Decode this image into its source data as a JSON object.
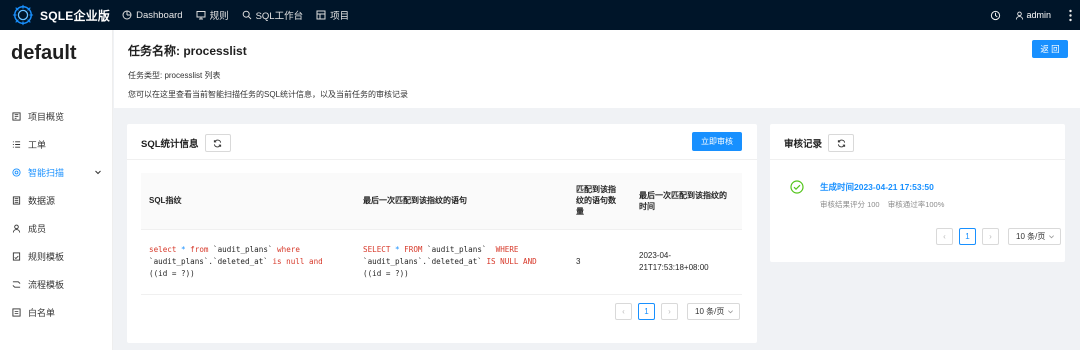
{
  "app": {
    "title": "SQLE企业版"
  },
  "nav": [
    {
      "label": "Dashboard",
      "icon": "dashboard-icon"
    },
    {
      "label": "规则",
      "icon": "monitor-icon"
    },
    {
      "label": "SQL工作台",
      "icon": "search-icon"
    },
    {
      "label": "项目",
      "icon": "project-icon"
    }
  ],
  "user": {
    "name": "admin"
  },
  "sidebar": {
    "project": "default",
    "items": [
      {
        "label": "项目概览",
        "icon": "overview-icon"
      },
      {
        "label": "工单",
        "icon": "list-icon"
      },
      {
        "label": "智能扫描",
        "icon": "scan-icon",
        "active": true
      },
      {
        "label": "数据源",
        "icon": "database-icon"
      },
      {
        "label": "成员",
        "icon": "user-icon"
      },
      {
        "label": "规则模板",
        "icon": "rule-template-icon"
      },
      {
        "label": "流程模板",
        "icon": "flow-icon"
      },
      {
        "label": "白名单",
        "icon": "whitelist-icon"
      }
    ]
  },
  "task": {
    "title": "任务名称: processlist",
    "type": "任务类型: processlist 列表",
    "desc": "您可以在这里查看当前智能扫描任务的SQL统计信息，以及当前任务的审核记录",
    "back": "返 回"
  },
  "stats": {
    "title": "SQL统计信息",
    "audit_button": "立即审核",
    "columns": [
      "SQL指纹",
      "最后一次匹配到该指纹的语句",
      "匹配到该指纹的语句数量",
      "最后一次匹配到该指纹的时间"
    ],
    "rows": [
      {
        "count": "3",
        "time": "2023-04-21T17:53:18+08:00"
      }
    ],
    "pagination": {
      "current": "1",
      "page_size": "10 条/页"
    }
  },
  "records": {
    "title": "审核记录",
    "items": [
      {
        "title": "生成时间2023-04-21 17:53:50",
        "score": "审核结果评分 100",
        "pass_rate": "审核通过率100%"
      }
    ],
    "pagination": {
      "current": "1",
      "page_size": "10 条/页"
    }
  },
  "colors": {
    "primary": "#1890ff",
    "topbar": "#001529",
    "keyword": "#d7392a",
    "success": "#52c41a"
  }
}
